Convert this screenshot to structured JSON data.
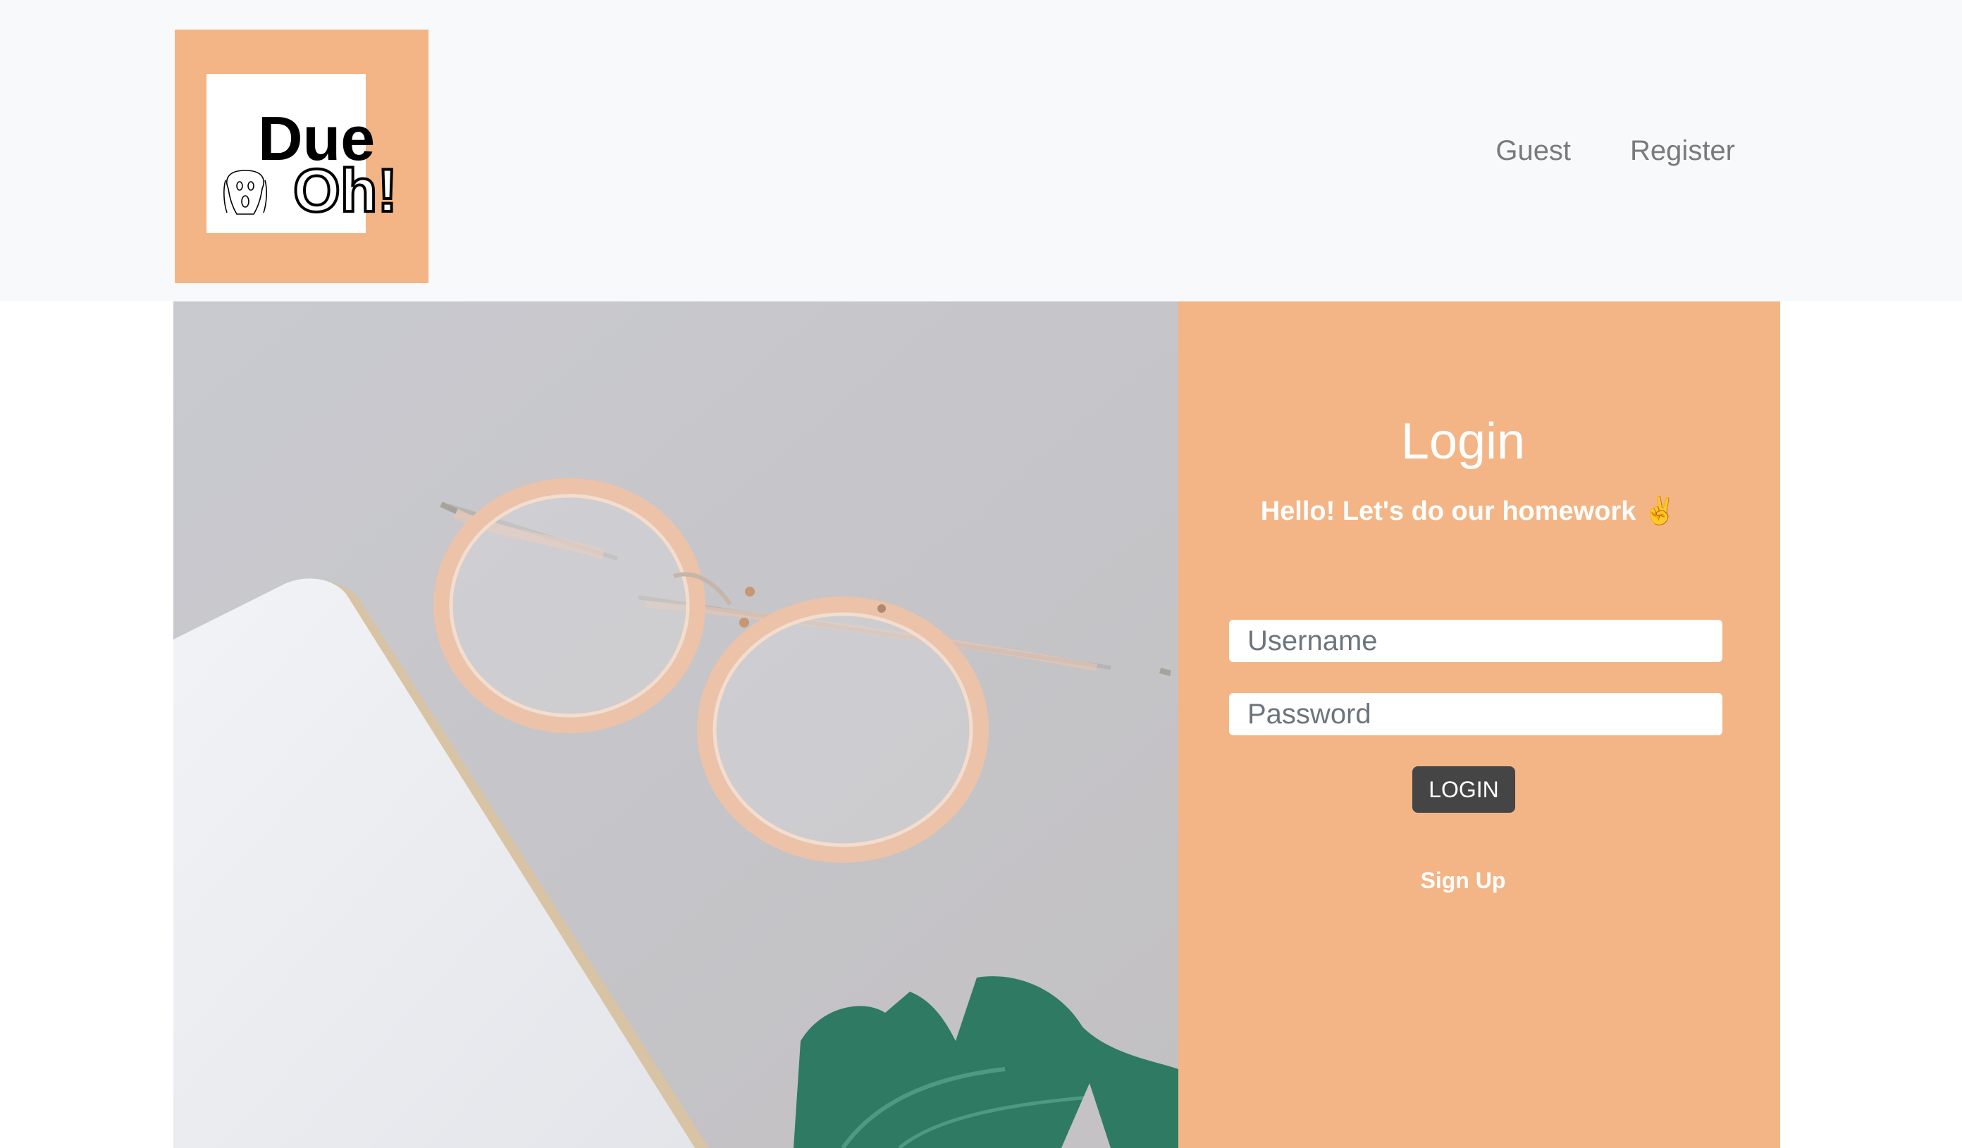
{
  "header": {
    "logo": {
      "line1": "Due",
      "line2": "Oh!",
      "icon": "scream-face-icon"
    },
    "nav": {
      "guest": "Guest",
      "register": "Register"
    }
  },
  "hero_image": {
    "description_icon": "glasses-notebook-leaf-photo"
  },
  "login": {
    "title": "Login",
    "subtitle": "Hello! Let's do our homework ✌️",
    "username_placeholder": "Username",
    "password_placeholder": "Password",
    "button_label": "LOGIN",
    "signup_label": "Sign Up"
  },
  "colors": {
    "accent": "#f3b585",
    "navbar_bg": "#f8f9fa",
    "button_bg": "#454545"
  }
}
